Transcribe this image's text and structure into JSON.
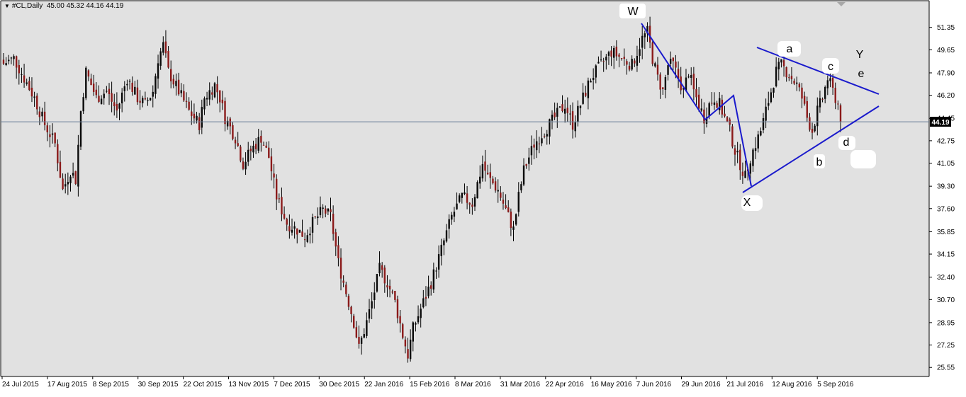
{
  "header": {
    "arrow": "▼",
    "symbol": "#CL,Daily",
    "ohlc": "45.00 45.32 44.16 44.19"
  },
  "colors": {
    "background": "#e1e1e1",
    "border": "#000000",
    "candle_up": "#0a0a0a",
    "candle_down": "#8b1a1a",
    "wick": "#000000",
    "pattern_lines": "#1a1acc",
    "current_price_line": "#6a7f99",
    "price_tag_bg": "#000000",
    "price_tag_text": "#ffffff"
  },
  "chart_data": {
    "type": "candlestick",
    "symbol": "#CL",
    "timeframe": "Daily",
    "grid": false,
    "current_price": "44.19",
    "ylim": [
      25.4,
      53.0
    ],
    "y_ticks": [
      "51.35",
      "49.65",
      "47.90",
      "46.20",
      "44.45",
      "42.75",
      "41.05",
      "39.30",
      "37.60",
      "35.85",
      "34.15",
      "32.40",
      "30.70",
      "28.95",
      "27.25",
      "25.55"
    ],
    "x_tick_labels": [
      "24 Jul 2015",
      "17 Aug 2015",
      "8 Sep 2015",
      "30 Sep 2015",
      "22 Oct 2015",
      "13 Nov 2015",
      "7 Dec 2015",
      "30 Dec 2015",
      "22 Jan 2016",
      "15 Feb 2016",
      "8 Mar 2016",
      "31 Mar 2016",
      "22 Apr 2016",
      "16 May 2016",
      "7 Jun 2016",
      "29 Jun 2016",
      "21 Jul 2016",
      "12 Aug 2016",
      "5 Sep 2016"
    ],
    "price_path": [
      [
        0,
        48.6
      ],
      [
        4,
        49.0
      ],
      [
        8,
        47.5
      ],
      [
        12,
        46.0
      ],
      [
        16,
        44.0
      ],
      [
        20,
        42.5
      ],
      [
        23,
        39.0
      ],
      [
        26,
        40.5
      ],
      [
        28,
        39.8
      ],
      [
        30,
        45.0
      ],
      [
        32,
        48.0
      ],
      [
        36,
        46.0
      ],
      [
        40,
        46.5
      ],
      [
        44,
        45.0
      ],
      [
        48,
        47.5
      ],
      [
        52,
        46.0
      ],
      [
        55,
        45.5
      ],
      [
        58,
        46.5
      ],
      [
        60,
        49.0
      ],
      [
        62,
        50.0
      ],
      [
        64,
        48.0
      ],
      [
        68,
        46.5
      ],
      [
        72,
        45.0
      ],
      [
        76,
        44.0
      ],
      [
        78,
        46.0
      ],
      [
        82,
        47.0
      ],
      [
        84,
        46.0
      ],
      [
        86,
        44.5
      ],
      [
        90,
        43.0
      ],
      [
        93,
        41.0
      ],
      [
        96,
        42.0
      ],
      [
        100,
        43.0
      ],
      [
        103,
        41.5
      ],
      [
        106,
        38.5
      ],
      [
        110,
        36.5
      ],
      [
        114,
        36.0
      ],
      [
        117,
        35.5
      ],
      [
        120,
        36.5
      ],
      [
        124,
        37.5
      ],
      [
        127,
        37.0
      ],
      [
        130,
        33.5
      ],
      [
        134,
        30.5
      ],
      [
        136,
        29.0
      ],
      [
        138,
        27.0
      ],
      [
        141,
        29.0
      ],
      [
        143,
        30.5
      ],
      [
        146,
        33.0
      ],
      [
        149,
        32.0
      ],
      [
        152,
        30.5
      ],
      [
        155,
        28.0
      ],
      [
        157,
        26.5
      ],
      [
        159,
        28.5
      ],
      [
        162,
        30.0
      ],
      [
        166,
        32.0
      ],
      [
        170,
        34.5
      ],
      [
        174,
        37.0
      ],
      [
        178,
        38.5
      ],
      [
        182,
        38.0
      ],
      [
        186,
        41.0
      ],
      [
        188,
        40.0
      ],
      [
        192,
        39.0
      ],
      [
        195,
        37.5
      ],
      [
        198,
        36.0
      ],
      [
        200,
        38.5
      ],
      [
        202,
        40.5
      ],
      [
        206,
        42.5
      ],
      [
        210,
        43.5
      ],
      [
        214,
        44.5
      ],
      [
        218,
        45.5
      ],
      [
        221,
        44.0
      ],
      [
        224,
        45.5
      ],
      [
        228,
        47.5
      ],
      [
        232,
        48.5
      ],
      [
        236,
        49.5
      ],
      [
        240,
        49.0
      ],
      [
        244,
        48.5
      ],
      [
        248,
        50.5
      ],
      [
        250,
        51.0
      ],
      [
        252,
        49.0
      ],
      [
        254,
        47.5
      ],
      [
        256,
        46.5
      ],
      [
        258,
        48.5
      ],
      [
        260,
        48.5
      ],
      [
        262,
        47.5
      ],
      [
        264,
        46.5
      ],
      [
        266,
        48.0
      ],
      [
        268,
        46.5
      ],
      [
        270,
        45.5
      ],
      [
        272,
        44.5
      ],
      [
        274,
        45.5
      ],
      [
        276,
        46.0
      ],
      [
        278,
        45.5
      ],
      [
        280,
        44.5
      ],
      [
        282,
        43.5
      ],
      [
        284,
        42.0
      ],
      [
        286,
        41.0
      ],
      [
        288,
        40.0
      ],
      [
        290,
        41.5
      ],
      [
        292,
        42.5
      ],
      [
        294,
        43.5
      ],
      [
        296,
        45.0
      ],
      [
        298,
        46.5
      ],
      [
        300,
        48.0
      ],
      [
        302,
        48.5
      ],
      [
        304,
        48.0
      ],
      [
        306,
        47.5
      ],
      [
        308,
        47.0
      ],
      [
        310,
        46.0
      ],
      [
        312,
        44.5
      ],
      [
        314,
        43.5
      ],
      [
        316,
        45.0
      ],
      [
        318,
        46.0
      ],
      [
        320,
        47.5
      ],
      [
        322,
        46.5
      ],
      [
        324,
        45.5
      ],
      [
        325,
        44.19
      ]
    ]
  },
  "annotations": {
    "W": "W",
    "X": "X",
    "Y": "Y",
    "a": "a",
    "b": "b",
    "c": "c",
    "d": "d",
    "e": "e"
  }
}
